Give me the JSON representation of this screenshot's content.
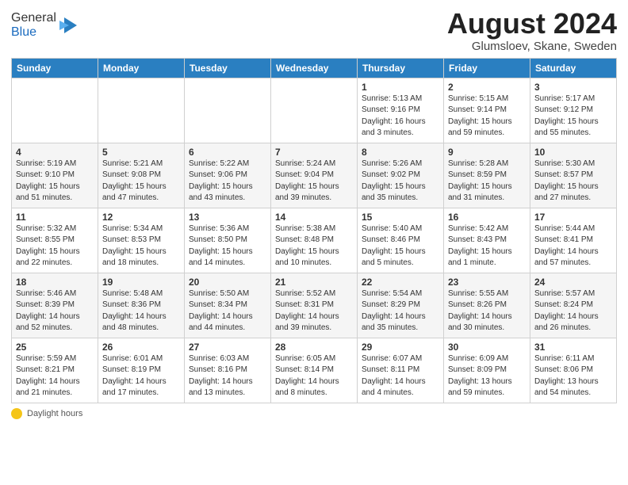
{
  "header": {
    "logo_general": "General",
    "logo_blue": "Blue",
    "month_title": "August 2024",
    "location": "Glumsloev, Skane, Sweden"
  },
  "days_of_week": [
    "Sunday",
    "Monday",
    "Tuesday",
    "Wednesday",
    "Thursday",
    "Friday",
    "Saturday"
  ],
  "weeks": [
    [
      {
        "day": "",
        "info": ""
      },
      {
        "day": "",
        "info": ""
      },
      {
        "day": "",
        "info": ""
      },
      {
        "day": "",
        "info": ""
      },
      {
        "day": "1",
        "info": "Sunrise: 5:13 AM\nSunset: 9:16 PM\nDaylight: 16 hours\nand 3 minutes."
      },
      {
        "day": "2",
        "info": "Sunrise: 5:15 AM\nSunset: 9:14 PM\nDaylight: 15 hours\nand 59 minutes."
      },
      {
        "day": "3",
        "info": "Sunrise: 5:17 AM\nSunset: 9:12 PM\nDaylight: 15 hours\nand 55 minutes."
      }
    ],
    [
      {
        "day": "4",
        "info": "Sunrise: 5:19 AM\nSunset: 9:10 PM\nDaylight: 15 hours\nand 51 minutes."
      },
      {
        "day": "5",
        "info": "Sunrise: 5:21 AM\nSunset: 9:08 PM\nDaylight: 15 hours\nand 47 minutes."
      },
      {
        "day": "6",
        "info": "Sunrise: 5:22 AM\nSunset: 9:06 PM\nDaylight: 15 hours\nand 43 minutes."
      },
      {
        "day": "7",
        "info": "Sunrise: 5:24 AM\nSunset: 9:04 PM\nDaylight: 15 hours\nand 39 minutes."
      },
      {
        "day": "8",
        "info": "Sunrise: 5:26 AM\nSunset: 9:02 PM\nDaylight: 15 hours\nand 35 minutes."
      },
      {
        "day": "9",
        "info": "Sunrise: 5:28 AM\nSunset: 8:59 PM\nDaylight: 15 hours\nand 31 minutes."
      },
      {
        "day": "10",
        "info": "Sunrise: 5:30 AM\nSunset: 8:57 PM\nDaylight: 15 hours\nand 27 minutes."
      }
    ],
    [
      {
        "day": "11",
        "info": "Sunrise: 5:32 AM\nSunset: 8:55 PM\nDaylight: 15 hours\nand 22 minutes."
      },
      {
        "day": "12",
        "info": "Sunrise: 5:34 AM\nSunset: 8:53 PM\nDaylight: 15 hours\nand 18 minutes."
      },
      {
        "day": "13",
        "info": "Sunrise: 5:36 AM\nSunset: 8:50 PM\nDaylight: 15 hours\nand 14 minutes."
      },
      {
        "day": "14",
        "info": "Sunrise: 5:38 AM\nSunset: 8:48 PM\nDaylight: 15 hours\nand 10 minutes."
      },
      {
        "day": "15",
        "info": "Sunrise: 5:40 AM\nSunset: 8:46 PM\nDaylight: 15 hours\nand 5 minutes."
      },
      {
        "day": "16",
        "info": "Sunrise: 5:42 AM\nSunset: 8:43 PM\nDaylight: 15 hours\nand 1 minute."
      },
      {
        "day": "17",
        "info": "Sunrise: 5:44 AM\nSunset: 8:41 PM\nDaylight: 14 hours\nand 57 minutes."
      }
    ],
    [
      {
        "day": "18",
        "info": "Sunrise: 5:46 AM\nSunset: 8:39 PM\nDaylight: 14 hours\nand 52 minutes."
      },
      {
        "day": "19",
        "info": "Sunrise: 5:48 AM\nSunset: 8:36 PM\nDaylight: 14 hours\nand 48 minutes."
      },
      {
        "day": "20",
        "info": "Sunrise: 5:50 AM\nSunset: 8:34 PM\nDaylight: 14 hours\nand 44 minutes."
      },
      {
        "day": "21",
        "info": "Sunrise: 5:52 AM\nSunset: 8:31 PM\nDaylight: 14 hours\nand 39 minutes."
      },
      {
        "day": "22",
        "info": "Sunrise: 5:54 AM\nSunset: 8:29 PM\nDaylight: 14 hours\nand 35 minutes."
      },
      {
        "day": "23",
        "info": "Sunrise: 5:55 AM\nSunset: 8:26 PM\nDaylight: 14 hours\nand 30 minutes."
      },
      {
        "day": "24",
        "info": "Sunrise: 5:57 AM\nSunset: 8:24 PM\nDaylight: 14 hours\nand 26 minutes."
      }
    ],
    [
      {
        "day": "25",
        "info": "Sunrise: 5:59 AM\nSunset: 8:21 PM\nDaylight: 14 hours\nand 21 minutes."
      },
      {
        "day": "26",
        "info": "Sunrise: 6:01 AM\nSunset: 8:19 PM\nDaylight: 14 hours\nand 17 minutes."
      },
      {
        "day": "27",
        "info": "Sunrise: 6:03 AM\nSunset: 8:16 PM\nDaylight: 14 hours\nand 13 minutes."
      },
      {
        "day": "28",
        "info": "Sunrise: 6:05 AM\nSunset: 8:14 PM\nDaylight: 14 hours\nand 8 minutes."
      },
      {
        "day": "29",
        "info": "Sunrise: 6:07 AM\nSunset: 8:11 PM\nDaylight: 14 hours\nand 4 minutes."
      },
      {
        "day": "30",
        "info": "Sunrise: 6:09 AM\nSunset: 8:09 PM\nDaylight: 13 hours\nand 59 minutes."
      },
      {
        "day": "31",
        "info": "Sunrise: 6:11 AM\nSunset: 8:06 PM\nDaylight: 13 hours\nand 54 minutes."
      }
    ]
  ],
  "footer": {
    "label": "Daylight hours"
  }
}
